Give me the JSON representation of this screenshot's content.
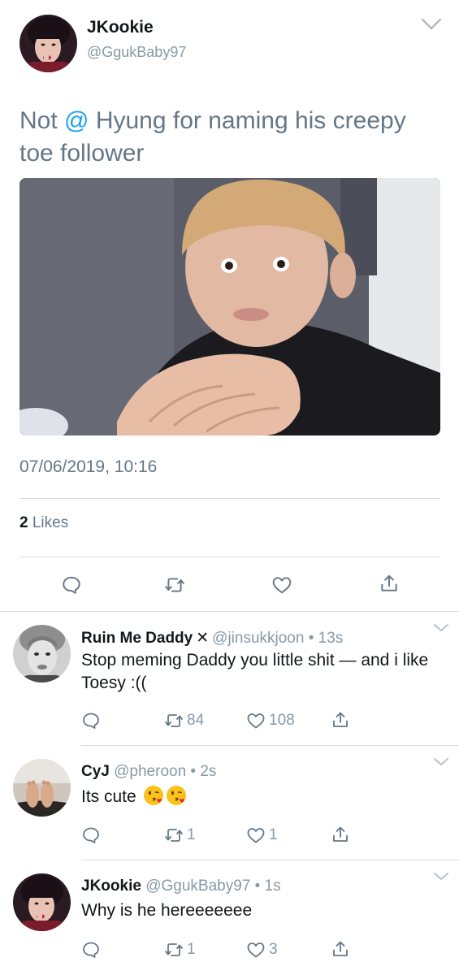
{
  "main_tweet": {
    "author_name": "JKookie",
    "author_handle": "@GgukBaby97",
    "text_prefix": "Not ",
    "mention": "@",
    "text_rest": " Hyung for naming his creepy toe follower",
    "timestamp": "07/06/2019, 10:16",
    "likes_count": "2",
    "likes_label": "Likes",
    "icons": [
      "reply-icon",
      "retweet-icon",
      "like-icon",
      "share-icon"
    ]
  },
  "replies": [
    {
      "name": "Ruin Me Daddy",
      "badge": "✕",
      "meta": "@jinsukkjoon • 13s",
      "text": "Stop meming Daddy you little shit — and i like Toesy :((",
      "retweets": "84",
      "likes": "108"
    },
    {
      "name": "CyJ",
      "meta": "@pheroon • 2s",
      "text": "Its cute",
      "emoji": [
        "😘",
        "😘"
      ],
      "retweets": "1",
      "likes": "1"
    },
    {
      "name": "JKookie",
      "meta": "@GgukBaby97 • 1s",
      "text": "Why is he hereeeeeee",
      "retweets": "1",
      "likes": "3"
    }
  ],
  "colors": {
    "link": "#1da1f2",
    "secondary_text": "#657786",
    "muted": "#8899a6",
    "divider": "#d6dde3"
  }
}
